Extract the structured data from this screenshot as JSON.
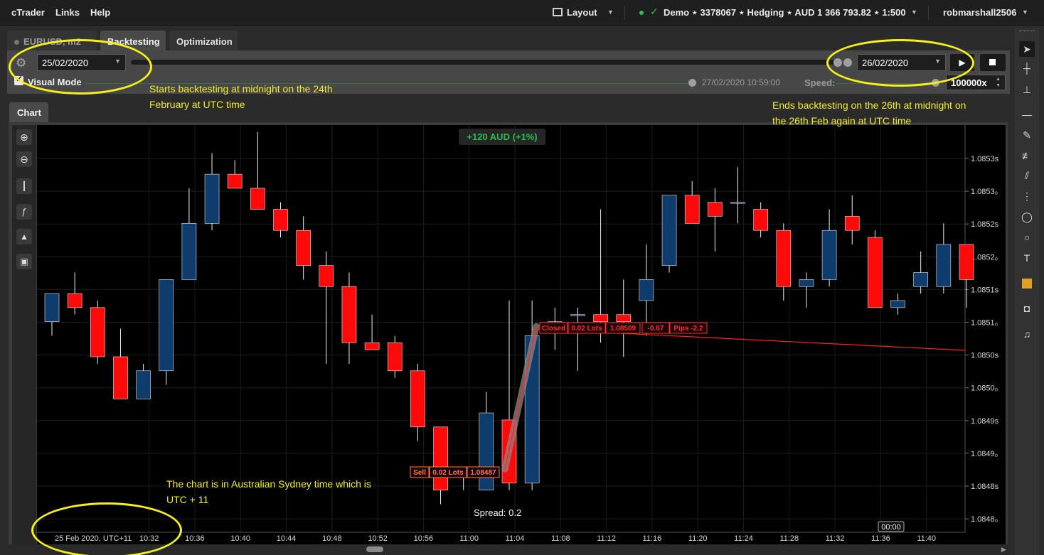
{
  "menu": {
    "app": "cTrader",
    "links": "Links",
    "help": "Help"
  },
  "topbar": {
    "layout_label": "Layout",
    "account_info": "Demo ⋆ 3378067 ⋆ Hedging ⋆ AUD 1 366 793.82 ⋆ 1:500",
    "username": "robmarshall2506"
  },
  "tabs": {
    "symbol": "EURUSD, m2",
    "backtesting": "Backtesting",
    "optimization": "Optimization"
  },
  "backtest": {
    "start_date": "25/02/2020",
    "end_date": "26/02/2020",
    "visual_mode_label": "Visual Mode",
    "current_time": "27/02/2020 10:59:00",
    "speed_label": "Speed:",
    "speed_value": "100000x",
    "progress": 1.0
  },
  "chart_tab_label": "Chart",
  "chart": {
    "profit_badge": "+120 AUD (+1%)",
    "spread_label": "Spread:",
    "spread_value": "0.2",
    "time_marker": "00:00",
    "date_label": "25 Feb 2020, UTC+11",
    "closed_trade": {
      "status": "Closed",
      "lots": "0.02 Lots",
      "price": "1.08509",
      "pnl": "-0.67",
      "pips": "Pips -2.2"
    },
    "open_trade": {
      "side": "Sell",
      "lots": "0.02 Lots",
      "price": "1.08487"
    }
  },
  "annotations": {
    "start_note_1": "Starts backtesting at midnight on the 24th",
    "start_note_2": "February at UTC time",
    "end_note_1": "Ends backtesting on the 26th at midnight on",
    "end_note_2": "the 26th Feb again at UTC time",
    "tz_note_1": "The chart is in Australian Sydney time which is",
    "tz_note_2": "UTC + 11"
  },
  "colors": {
    "bull": "#0e3c6c",
    "bear": "#ff0a0a",
    "annotation": "#f2ec30",
    "profit": "#27c04a"
  },
  "chart_data": {
    "type": "candlestick",
    "symbol": "EURUSD",
    "timeframe": "m2",
    "ylim": [
      1.08478,
      1.08536
    ],
    "y_ticks": [
      "1.0853s",
      "1.0853₀",
      "1.0852s",
      "1.0852₀",
      "1.0851s",
      "1.0851₀",
      "1.0850s",
      "1.0850₀",
      "1.0849s",
      "1.0849₀",
      "1.0848s",
      "1.0848₀"
    ],
    "x_ticks": [
      "25 Feb 2020, UTC+11",
      "10:32",
      "10:36",
      "10:40",
      "10:44",
      "10:48",
      "10:52",
      "10:56",
      "11:00",
      "11:04",
      "11:08",
      "11:12",
      "11:16",
      "11:20",
      "11:24",
      "11:28",
      "11:32",
      "11:36",
      "11:40"
    ],
    "x": [
      "10:22",
      "10:24",
      "10:26",
      "10:28",
      "10:30",
      "10:32",
      "10:34",
      "10:36",
      "10:38",
      "10:40",
      "10:42",
      "10:44",
      "10:46",
      "10:48",
      "10:50",
      "10:52",
      "10:54",
      "10:56",
      "10:58",
      "11:00",
      "11:02",
      "11:04",
      "11:06",
      "11:08",
      "11:10",
      "11:12",
      "11:14",
      "11:16",
      "11:18",
      "11:20",
      "11:22",
      "11:24",
      "11:26",
      "11:28",
      "11:30",
      "11:32",
      "11:34",
      "11:36",
      "11:38",
      "11:40",
      "11:42"
    ],
    "ohlc": [
      [
        1.08508,
        1.08512,
        1.08506,
        1.08512
      ],
      [
        1.08512,
        1.08515,
        1.08509,
        1.0851
      ],
      [
        1.0851,
        1.08511,
        1.08502,
        1.08503
      ],
      [
        1.08503,
        1.08507,
        1.08497,
        1.08497
      ],
      [
        1.08497,
        1.08502,
        1.08497,
        1.08501
      ],
      [
        1.08501,
        1.08514,
        1.08499,
        1.08514
      ],
      [
        1.08514,
        1.08527,
        1.08514,
        1.08522
      ],
      [
        1.08522,
        1.08532,
        1.08521,
        1.08529
      ],
      [
        1.08529,
        1.08531,
        1.08527,
        1.08527
      ],
      [
        1.08527,
        1.08535,
        1.08524,
        1.08524
      ],
      [
        1.08524,
        1.08525,
        1.0852,
        1.08521
      ],
      [
        1.08521,
        1.08523,
        1.08514,
        1.08516
      ],
      [
        1.08516,
        1.08518,
        1.08502,
        1.08513
      ],
      [
        1.08513,
        1.08515,
        1.08502,
        1.08505
      ],
      [
        1.08505,
        1.08509,
        1.08504,
        1.08504
      ],
      [
        1.08505,
        1.08506,
        1.085,
        1.08501
      ],
      [
        1.08501,
        1.08502,
        1.08491,
        1.08493
      ],
      [
        1.08493,
        1.08493,
        1.08482,
        1.08484
      ],
      [
        1.08487,
        1.08487,
        1.08484,
        1.08486
      ],
      [
        1.08484,
        1.08498,
        1.08484,
        1.08495
      ],
      [
        1.08494,
        1.08511,
        1.08484,
        1.08485
      ],
      [
        1.08485,
        1.08511,
        1.08484,
        1.08506
      ],
      [
        1.08508,
        1.0851,
        1.08504,
        1.08508
      ],
      [
        1.08509,
        1.0851,
        1.08501,
        1.08509
      ],
      [
        1.08509,
        1.08524,
        1.08505,
        1.08508
      ],
      [
        1.08509,
        1.08514,
        1.08503,
        1.08508
      ],
      [
        1.08511,
        1.08519,
        1.08506,
        1.08514
      ],
      [
        1.08516,
        1.08526,
        1.08515,
        1.08526
      ],
      [
        1.08526,
        1.08528,
        1.08522,
        1.08522
      ],
      [
        1.08525,
        1.08527,
        1.08518,
        1.08523
      ],
      [
        1.08525,
        1.0853,
        1.08522,
        1.08525
      ],
      [
        1.08524,
        1.08525,
        1.0852,
        1.08521
      ],
      [
        1.08521,
        1.08522,
        1.08511,
        1.08513
      ],
      [
        1.08513,
        1.08515,
        1.0851,
        1.08514
      ],
      [
        1.08514,
        1.08524,
        1.08513,
        1.08521
      ],
      [
        1.08523,
        1.08526,
        1.08519,
        1.08521
      ],
      [
        1.0852,
        1.08521,
        1.0851,
        1.0851
      ],
      [
        1.0851,
        1.08512,
        1.08509,
        1.08511
      ],
      [
        1.08513,
        1.08518,
        1.08512,
        1.08515
      ],
      [
        1.08513,
        1.08522,
        1.08512,
        1.08519
      ],
      [
        1.08519,
        1.08519,
        1.0851,
        1.08514
      ]
    ]
  }
}
